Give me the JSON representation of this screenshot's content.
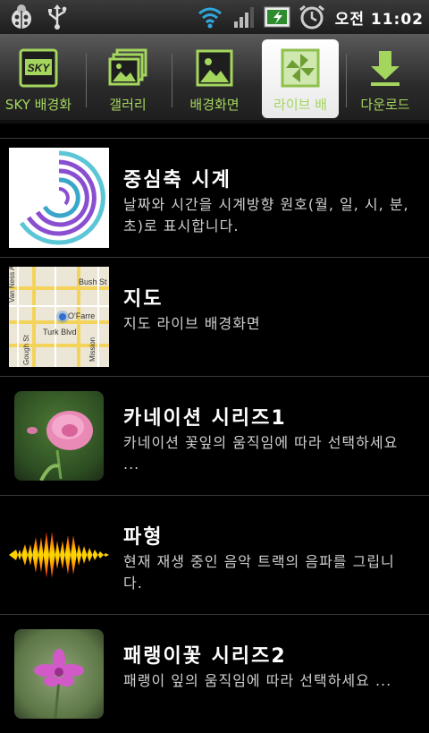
{
  "status_bar": {
    "time": "오전 11:02",
    "icons": [
      "ladybug-icon",
      "usb-icon",
      "wifi-icon",
      "signal-icon",
      "battery-charging-icon",
      "alarm-clock-icon"
    ]
  },
  "tabs": [
    {
      "label": "SKY 배경화",
      "icon": "sky-logo-icon"
    },
    {
      "label": "갤러리",
      "icon": "gallery-icon"
    },
    {
      "label": "배경화면",
      "icon": "wallpaper-icon"
    },
    {
      "label": "라이브 배",
      "icon": "pinwheel-icon",
      "active": true
    },
    {
      "label": "다운로드",
      "icon": "download-icon"
    }
  ],
  "items": [
    {
      "title": "중심축 시계",
      "description": "날짜와 시간을 시계방향 원호(월, 일, 시, 분, 초)로 표시합니다."
    },
    {
      "title": "지도",
      "description": "지도 라이브 배경화면"
    },
    {
      "title": "카네이션 시리즈1",
      "description": "카네이션 꽃잎의 움직임에 따라 선택하세요 ..."
    },
    {
      "title": "파형",
      "description": "현재 재생 중인 음악 트랙의 음파를 그립니다."
    },
    {
      "title": "패랭이꽃 시리즈2",
      "description": "패랭이 잎의 움직임에 따라 선택하세요 ..."
    }
  ],
  "map_labels": {
    "van_ness": "Van Ness Ave",
    "bush": "Bush St",
    "ofarrell": "O'Farre",
    "turk": "Turk Blvd",
    "gough": "Gough St",
    "mission": "Mission"
  },
  "colors": {
    "accent": "#a4d65e",
    "background": "#000000"
  }
}
